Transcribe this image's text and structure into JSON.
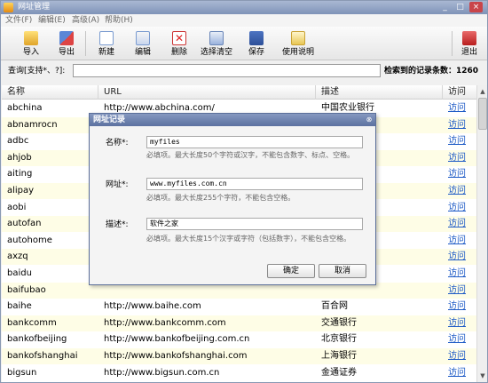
{
  "window": {
    "title": "网址管理",
    "controls": [
      "_",
      "□",
      "×"
    ]
  },
  "menu": [
    "文件(F)",
    "编辑(E)",
    "高级(A)",
    "帮助(H)"
  ],
  "toolbar": {
    "import": "导入",
    "export": "导出",
    "new": "新建",
    "edit": "编辑",
    "delete": "删除",
    "select_clear": "选择清空",
    "save": "保存",
    "help": "使用说明",
    "exit": "退出"
  },
  "search": {
    "label": "查询[支持*、?]:",
    "value": "",
    "count_label": "检索到的记录条数：1260"
  },
  "table": {
    "headers": [
      "名称",
      "URL",
      "描述",
      "访问"
    ],
    "visit_label": "访问",
    "rows": [
      {
        "name": "abchina",
        "url": "http://www.abchina.com/",
        "desc": "中国农业银行"
      },
      {
        "name": "abnamrocn",
        "url": "",
        "desc": ""
      },
      {
        "name": "adbc",
        "url": "",
        "desc": "银行"
      },
      {
        "name": "ahjob",
        "url": "",
        "desc": ""
      },
      {
        "name": "aiting",
        "url": "",
        "desc": ""
      },
      {
        "name": "alipay",
        "url": "",
        "desc": ""
      },
      {
        "name": "aobi",
        "url": "",
        "desc": ""
      },
      {
        "name": "autofan",
        "url": "",
        "desc": ""
      },
      {
        "name": "autohome",
        "url": "",
        "desc": ""
      },
      {
        "name": "axzq",
        "url": "",
        "desc": ""
      },
      {
        "name": "baidu",
        "url": "",
        "desc": ""
      },
      {
        "name": "baifubao",
        "url": "",
        "desc": ""
      },
      {
        "name": "baihe",
        "url": "http://www.baihe.com",
        "desc": "百合网"
      },
      {
        "name": "bankcomm",
        "url": "http://www.bankcomm.com",
        "desc": "交通银行"
      },
      {
        "name": "bankofbeijing",
        "url": "http://www.bankofbeijing.com.cn",
        "desc": "北京银行"
      },
      {
        "name": "bankofshanghai",
        "url": "http://www.bankofshanghai.com",
        "desc": "上海银行"
      },
      {
        "name": "bigsun",
        "url": "http://www.bigsun.com.cn",
        "desc": "金通证券"
      }
    ]
  },
  "dialog": {
    "title": "网址记录",
    "name_label": "名称*:",
    "name_value": "myfiles",
    "name_hint": "必填项。最大长度50个字符或汉字，不能包含数字、标点、空格。",
    "url_label": "网址*:",
    "url_value": "www.myfiles.com.cn",
    "url_hint": "必填项。最大长度255个字符，不能包含空格。",
    "desc_label": "描述*:",
    "desc_value": "软件之家",
    "desc_hint": "必填项。最大长度15个汉字或字符（包括数字），不能包含空格。",
    "ok": "确定",
    "cancel": "取消"
  },
  "colors": {
    "title_bar": "#7f93b8",
    "dialog_title": "#5c71a0",
    "row_alt": "#fefde6",
    "link": "#1e5bc6"
  }
}
